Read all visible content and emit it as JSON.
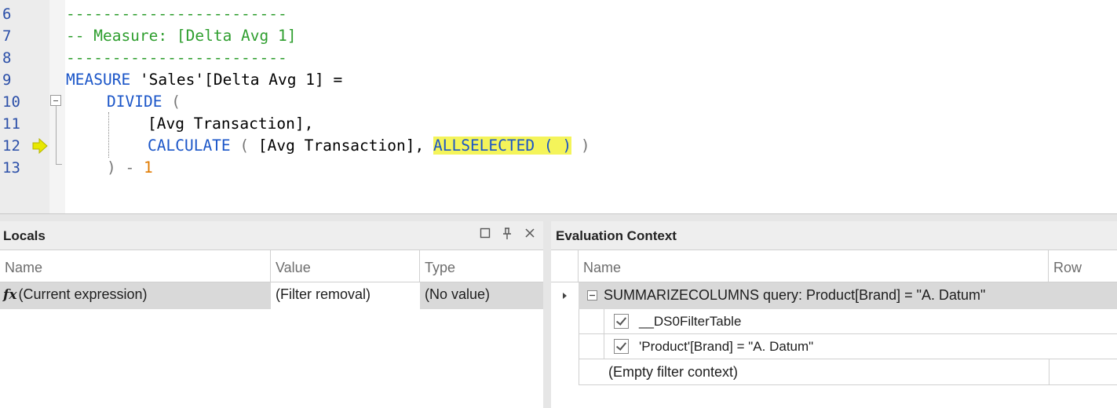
{
  "editor": {
    "line_numbers": [
      "6",
      "7",
      "8",
      "9",
      "10",
      "11",
      "12",
      "13"
    ],
    "lines": {
      "l6": "------------------------",
      "l7": "-- Measure: [Delta Avg 1]",
      "l8": "------------------------",
      "l9_kw": "MEASURE",
      "l9_rest": " 'Sales'[Delta Avg 1] =",
      "l10_kw": "DIVIDE",
      "l10_rest": " (",
      "l11": "[Avg Transaction],",
      "l12_kw": "CALCULATE",
      "l12_p1": " ( ",
      "l12_mid": "[Avg Transaction],",
      "l12_hl": "ALLSELECTED ( )",
      "l12_end": " )",
      "l13_a": ") - ",
      "l13_num": "1"
    }
  },
  "locals": {
    "title": "Locals",
    "columns": [
      "Name",
      "Value",
      "Type"
    ],
    "row": {
      "icon": "fx",
      "name": "(Current expression)",
      "value": "(Filter removal)",
      "type": "(No value)"
    }
  },
  "evaluation_context": {
    "title": "Evaluation Context",
    "columns": [
      "Name",
      "Row"
    ],
    "group": "SUMMARIZECOLUMNS query: Product[Brand] = \"A. Datum\"",
    "items": [
      "__DS0FilterTable",
      "'Product'[Brand] = \"A. Datum\""
    ],
    "empty": "(Empty filter context)"
  },
  "colors": {
    "highlight": "#f4f45a",
    "keyword": "#1a55c8",
    "comment": "#2e9e2e",
    "number": "#e07a00",
    "exec_arrow": "#e8e800"
  }
}
